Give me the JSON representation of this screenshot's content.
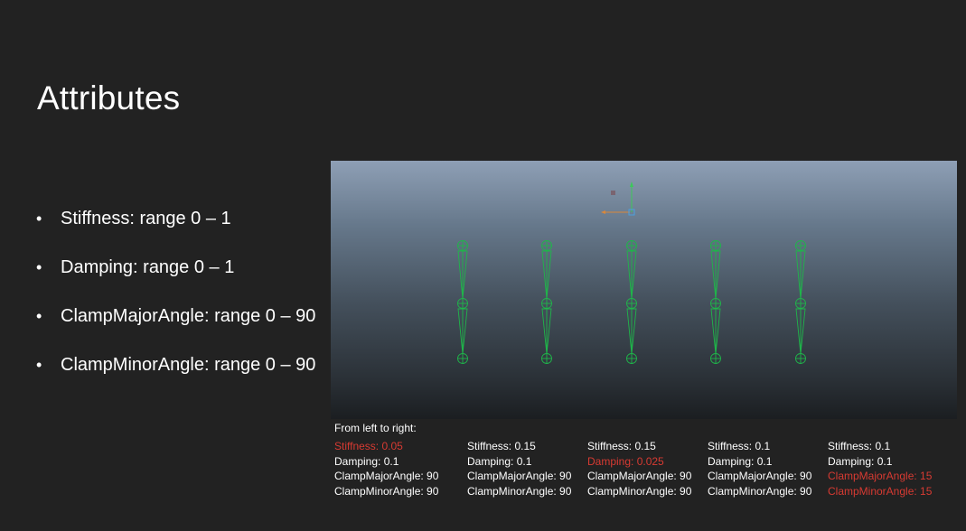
{
  "slide": {
    "title": "Attributes",
    "bullets": [
      "Stiffness: range 0 – 1",
      "Damping: range 0 – 1",
      "ClampMajorAngle: range 0 – 90",
      "ClampMinorAngle: range 0 – 90"
    ]
  },
  "caption": "From left to right:",
  "columns": [
    {
      "stiffness": "Stiffness:  0.05",
      "damping": "Damping: 0.1",
      "clamp_major": "ClampMajorAngle: 90",
      "clamp_minor": "ClampMinorAngle: 90",
      "highlight": "stiffness"
    },
    {
      "stiffness": "Stiffness:  0.15",
      "damping": "Damping: 0.1",
      "clamp_major": "ClampMajorAngle: 90",
      "clamp_minor": "ClampMinorAngle: 90",
      "highlight": ""
    },
    {
      "stiffness": "Stiffness:  0.15",
      "damping": "Damping: 0.025",
      "clamp_major": "ClampMajorAngle: 90",
      "clamp_minor": "ClampMinorAngle: 90",
      "highlight": "damping"
    },
    {
      "stiffness": "Stiffness:  0.1",
      "damping": "Damping: 0.1",
      "clamp_major": "ClampMajorAngle: 90",
      "clamp_minor": "ClampMinorAngle: 90",
      "highlight": ""
    },
    {
      "stiffness": "Stiffness:  0.1",
      "damping": "Damping: 0.1",
      "clamp_major": "ClampMajorAngle: 15",
      "clamp_minor": "ClampMinorAngle: 15",
      "highlight": "clamp"
    }
  ],
  "colors": {
    "background": "#222222",
    "highlight": "#d73a32",
    "joint": "#1fb64a"
  }
}
